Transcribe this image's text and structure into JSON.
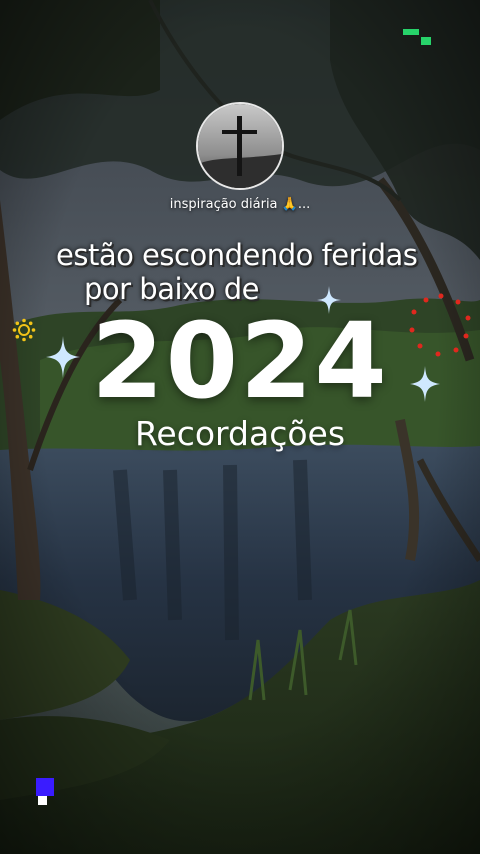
{
  "profile": {
    "avatar_icon": "cross-on-hill-icon",
    "name": "inspiração diária 🙏..."
  },
  "caption": {
    "line1": "estão escondendo feridas",
    "line2": "por baixo de"
  },
  "headline": {
    "year": "2024",
    "subtitle": "Recordações"
  },
  "decorations": {
    "sparkle_icon": "sparkle-icon",
    "sun_icon": "sun-icon",
    "dot_ring_icon": "dot-ring-icon",
    "pixel_marks_icon": "pixel-icon"
  },
  "colors": {
    "sparkle": "#cfe8ff",
    "sun": "#f2c318",
    "dot_ring": "#e0281e",
    "pixel_green": "#27d36a",
    "pixel_blue": "#3a1cff"
  }
}
